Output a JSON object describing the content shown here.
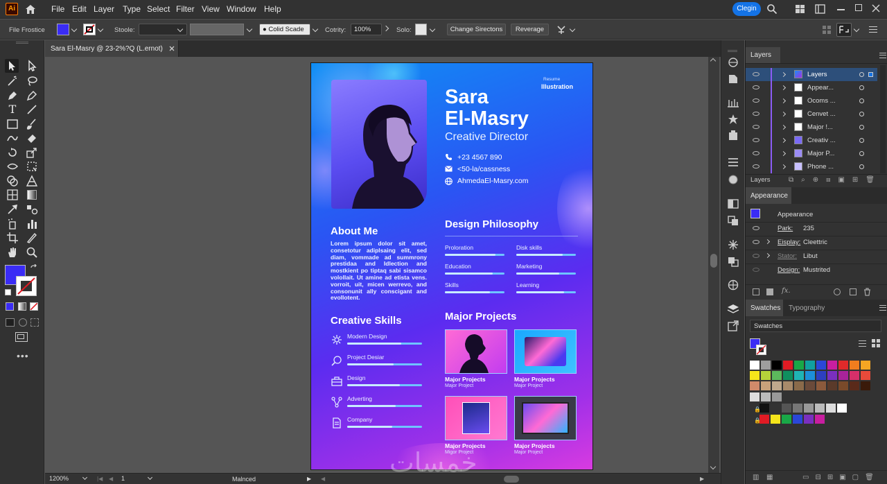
{
  "menubar": {
    "items": [
      "File",
      "Edit",
      "Layer",
      "Type",
      "Select",
      "Filter",
      "View",
      "Window",
      "Help"
    ],
    "login": "Clegin"
  },
  "controlbar": {
    "tool_name": "File Frostice",
    "stroke_label": "Stoole:",
    "style_value": "Colid Scade",
    "opacity_label": "Cotrity:",
    "opacity_value": "100%",
    "solo_label": "Solo:",
    "change_btn": "Change Sirectons",
    "reverage_btn": "Reverage"
  },
  "document": {
    "tab": "Sara El-Masry @ 23-2%?Q (L.ernot)",
    "zoom": "1200%",
    "page": "1",
    "status": "Malnced"
  },
  "resume": {
    "label_small": "Resume",
    "label_big": "Illustration",
    "first_name": "Sara",
    "last_name": "El-Masry",
    "role": "Creative Director",
    "phone": "+23 4567 890",
    "email": "<50-la/cassness",
    "web": "AhmedaEl-Masry.com",
    "about_title": "About Me",
    "about_text": "Lorem ipsum dolor sit amet, consetotur adiplsaing elit, sed diam, vommade ad summrony prestidaa and Idlection and mostkient po tiptaq sabi sisamco volollait. Ut amine ad etista vens. vorroit, uit, micen werrevo, and consonunit ally conscigant and evollotent.",
    "philosophy_title": "Design Philosophy",
    "philosophy": [
      {
        "label": "Proloration",
        "level": 0.85
      },
      {
        "label": "Disk skills",
        "level": 0.78
      },
      {
        "label": "Education",
        "level": 0.8
      },
      {
        "label": "Marketing",
        "level": 0.72
      },
      {
        "label": "Skills",
        "level": 0.75
      },
      {
        "label": "Learning",
        "level": 0.8
      }
    ],
    "skills_title": "Creative Skills",
    "skills": [
      {
        "label": "Modern Design",
        "level": 0.72,
        "icon": "gear-icon"
      },
      {
        "label": "Project Desiar",
        "level": 0.62,
        "icon": "magnifier-icon"
      },
      {
        "label": "Design",
        "level": 0.7,
        "icon": "briefcase-icon"
      },
      {
        "label": "Adverting",
        "level": 0.65,
        "icon": "nodes-icon"
      },
      {
        "label": "Company",
        "level": 0.6,
        "icon": "document-icon"
      }
    ],
    "projects_title": "Major Projects",
    "projects": [
      {
        "title": "Major Projects",
        "sub": "Major Project"
      },
      {
        "title": "Major Projects",
        "sub": "Major Project"
      },
      {
        "title": "Major Projects",
        "sub": "Migor Project"
      },
      {
        "title": "Major Projects",
        "sub": "Major Project"
      }
    ],
    "watermark": "خمسات"
  },
  "layers_panel": {
    "tab": "Layers",
    "footer": "Layers",
    "rows": [
      "Layers",
      "Appear...",
      "Ocoms ...",
      "Cenvet ...",
      "Major !...",
      "Creativ ...",
      "Major P...",
      "Phone ..."
    ]
  },
  "appearance_panel": {
    "tab": "Appearance",
    "header": "Appearance",
    "rows": [
      {
        "label": "Park:",
        "value": "235"
      },
      {
        "label": "Eisplay:",
        "value": "Cleettric"
      },
      {
        "label": "Stator:",
        "value": "Libut"
      },
      {
        "label": "Design:",
        "value": "Mustrited"
      }
    ]
  },
  "swatches_panel": {
    "tab1": "Swatches",
    "tab2": "Typography",
    "dropdown": "Swatches",
    "colors": [
      [
        "#ffffff",
        "#9e9e9e",
        "#000000",
        "#e01b24",
        "#19a847",
        "#10a0a0",
        "#2a47d8",
        "#c81ea0",
        "#e02a2a",
        "#f07d1e",
        "#f5a623"
      ],
      [
        "#f5e51b",
        "#b5d23a",
        "#5cb85c",
        "#0f8f5f",
        "#1fb4b4",
        "#1d8fd8",
        "#2d3fbf",
        "#7a2fbf",
        "#a8239a",
        "#d62f6a",
        "#e84a3a"
      ],
      [
        "#d08a6a",
        "#c8a27a",
        "#bfa88c",
        "#a88a6a",
        "#8a6a4a",
        "#6a4a3a",
        "#8c5a3c",
        "#5a3a2a",
        "#7a4a2a",
        "#5a2a1a",
        "#3a1a0a"
      ],
      [
        "#dddddd",
        "#bbbbbb",
        "#999999"
      ],
      [
        "#111111",
        "#333333",
        "#555555",
        "#777777",
        "#999999",
        "#bbbbbb",
        "#dddddd",
        "#ffffff"
      ],
      [
        "#e01b24",
        "#f5e51b",
        "#19a847",
        "#2a47d8",
        "#7a2fbf",
        "#c81ea0"
      ]
    ]
  },
  "colors": {
    "fill": "#3a2cf5",
    "accent": "#1473e6"
  }
}
